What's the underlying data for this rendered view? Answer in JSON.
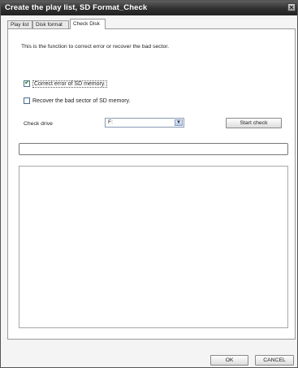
{
  "window": {
    "title": "Create the play list, SD Format_Check",
    "close_glyph": "✕"
  },
  "tabs": [
    {
      "label": "Play list",
      "active": false
    },
    {
      "label": "Disk format",
      "active": false
    },
    {
      "label": "Check Disk",
      "active": true
    }
  ],
  "check_disk": {
    "description": "This is the function to correct error or recover the bad sector.",
    "options": [
      {
        "label": "Correct error of SD memory.",
        "checked": true
      },
      {
        "label": "Recover the bad sector of SD memory.",
        "checked": false
      }
    ],
    "drive_label": "Check drive",
    "drive_value": "F:",
    "start_button": "Start check",
    "progress_percent": 0
  },
  "footer": {
    "ok_label": "OK",
    "cancel_label": "CANCEL"
  },
  "icons": {
    "checkmark": "check-icon",
    "dropdown": "chevron-down-icon",
    "close": "close-icon"
  },
  "colors": {
    "titlebar": "#2f2f2f",
    "check_green": "#2a8a1a"
  }
}
